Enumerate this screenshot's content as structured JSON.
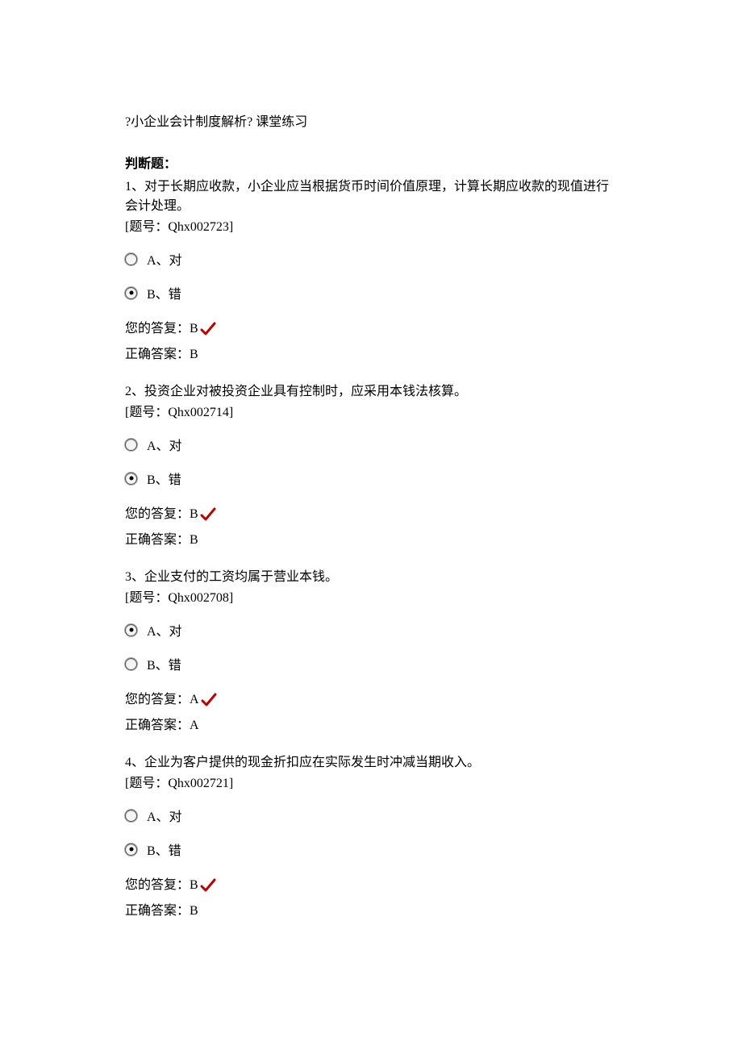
{
  "title": "?小企业会计制度解析? 课堂练习",
  "section_header": "判断题：",
  "labels": {
    "your_answer_prefix": "您的答复：",
    "correct_answer_prefix": "正确答案：",
    "id_prefix": "[题号：",
    "id_suffix": "]"
  },
  "questions": [
    {
      "number": "1",
      "text": "、对于长期应收款，小企业应当根据货币时间价值原理，计算长期应收款的现值进行会计处理。",
      "id": "Qhx002723",
      "options": [
        {
          "label": "A、对",
          "selected": false
        },
        {
          "label": "B、错",
          "selected": true
        }
      ],
      "your_answer": "B",
      "correct_answer": "B"
    },
    {
      "number": "2",
      "text": "、投资企业对被投资企业具有控制时，应采用本钱法核算。",
      "id": "Qhx002714",
      "options": [
        {
          "label": "A、对",
          "selected": false
        },
        {
          "label": "B、错",
          "selected": true
        }
      ],
      "your_answer": "B",
      "correct_answer": "B"
    },
    {
      "number": "3",
      "text": "、企业支付的工资均属于营业本钱。",
      "id": "Qhx002708",
      "options": [
        {
          "label": "A、对",
          "selected": true
        },
        {
          "label": "B、错",
          "selected": false
        }
      ],
      "your_answer": "A",
      "correct_answer": "A"
    },
    {
      "number": "4",
      "text": "、企业为客户提供的现金折扣应在实际发生时冲减当期收入。",
      "id": "Qhx002721",
      "options": [
        {
          "label": "A、对",
          "selected": false
        },
        {
          "label": "B、错",
          "selected": true
        }
      ],
      "your_answer": "B",
      "correct_answer": "B"
    }
  ]
}
